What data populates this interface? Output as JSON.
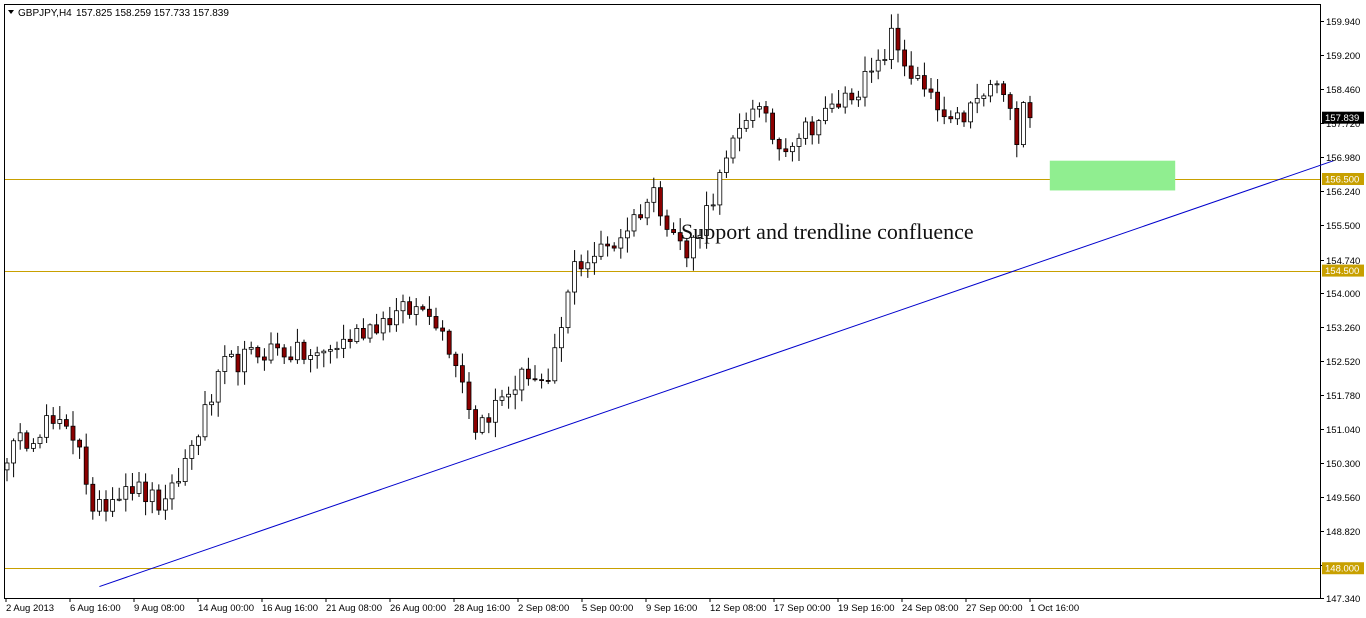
{
  "header": {
    "menu_icon": "triangle-down-icon",
    "symbol": "GBPJPY,H4",
    "ohlc": "157.825 158.259 157.733 157.839"
  },
  "colors": {
    "background": "#ffffff",
    "frame": "#000000",
    "bull_candle": "#ffffff",
    "bear_candle": "#8b0000",
    "wick": "#000000",
    "hline": "#c8a000",
    "trendline": "#0000cc",
    "zone": "#90ee90",
    "price_label_bg": "#c8a000",
    "current_price_bg": "#000000"
  },
  "annotation": "Support and trendline confluence",
  "chart_data": {
    "type": "candlestick",
    "symbol": "GBPJPY",
    "timeframe": "H4",
    "ylim": [
      147.35,
      160.3
    ],
    "y_ticks": [
      "159.940",
      "159.200",
      "158.460",
      "157.720",
      "156.980",
      "156.240",
      "155.500",
      "154.740",
      "154.000",
      "153.260",
      "152.520",
      "151.780",
      "151.040",
      "150.300",
      "149.560",
      "148.820",
      "148.080",
      "147.340"
    ],
    "x_labels": [
      "2 Aug 2013",
      "6 Aug 16:00",
      "9 Aug 08:00",
      "14 Aug 00:00",
      "16 Aug 16:00",
      "21 Aug 08:00",
      "26 Aug 00:00",
      "28 Aug 16:00",
      "2 Sep 08:00",
      "5 Sep 00:00",
      "9 Sep 16:00",
      "12 Sep 08:00",
      "17 Sep 00:00",
      "19 Sep 16:00",
      "24 Sep 08:00",
      "27 Sep 00:00",
      "1 Oct 16:00"
    ],
    "candle_count": 156,
    "waypoints": [
      {
        "i": 0,
        "price": 150.5
      },
      {
        "i": 6,
        "price": 151.2
      },
      {
        "i": 11,
        "price": 150.8
      },
      {
        "i": 13,
        "price": 149.1
      },
      {
        "i": 18,
        "price": 149.9
      },
      {
        "i": 24,
        "price": 149.3
      },
      {
        "i": 33,
        "price": 152.4
      },
      {
        "i": 40,
        "price": 152.8
      },
      {
        "i": 47,
        "price": 152.6
      },
      {
        "i": 55,
        "price": 153.3
      },
      {
        "i": 60,
        "price": 153.6
      },
      {
        "i": 64,
        "price": 153.7
      },
      {
        "i": 68,
        "price": 152.6
      },
      {
        "i": 71,
        "price": 151.1
      },
      {
        "i": 79,
        "price": 152.3
      },
      {
        "i": 82,
        "price": 151.9
      },
      {
        "i": 86,
        "price": 154.6
      },
      {
        "i": 92,
        "price": 155.1
      },
      {
        "i": 98,
        "price": 156.2
      },
      {
        "i": 103,
        "price": 154.8
      },
      {
        "i": 108,
        "price": 156.5
      },
      {
        "i": 113,
        "price": 158.2
      },
      {
        "i": 117,
        "price": 157.2
      },
      {
        "i": 124,
        "price": 157.9
      },
      {
        "i": 132,
        "price": 158.9
      },
      {
        "i": 134,
        "price": 159.6
      },
      {
        "i": 137,
        "price": 158.8
      },
      {
        "i": 143,
        "price": 157.6
      },
      {
        "i": 150,
        "price": 158.6
      },
      {
        "i": 153,
        "price": 157.5
      },
      {
        "i": 155,
        "price": 159.2
      }
    ],
    "horizontal_levels": [
      {
        "price": 156.5,
        "label": "156.500"
      },
      {
        "price": 154.5,
        "label": "154.500"
      },
      {
        "price": 148.0,
        "label": "148.000"
      }
    ],
    "current_price": {
      "price": 157.839,
      "label": "157.839"
    },
    "trendline": {
      "start": {
        "candle": 14,
        "price": 147.6
      },
      "end": {
        "candle": 201,
        "price": 156.9
      }
    },
    "support_zone": {
      "from_candle": 158,
      "to_candle": 177,
      "low": 156.25,
      "high": 156.9
    }
  }
}
